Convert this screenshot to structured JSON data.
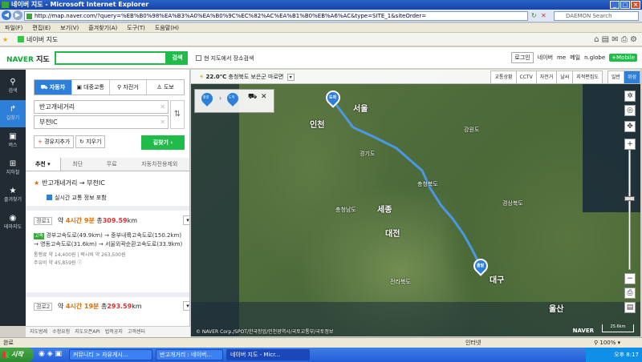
{
  "browser": {
    "title": "네이버 지도 - Microsoft Internet Explorer",
    "url": "http://map.naver.com/?query=%EB%B0%98%EA%B3%A0%EA%B0%9C%EC%82%AC%EA%B1%B0%EB%A6%AC&type=SITE_1&siteOrder=",
    "search_placeholder": "DAEMON Search",
    "menu": [
      "파일(F)",
      "편집(E)",
      "보기(V)",
      "즐겨찾기(A)",
      "도구(T)",
      "도움말(H)"
    ],
    "tab_label": "네이버 지도"
  },
  "header": {
    "logo": "NAVER",
    "logo_sub": "지도",
    "search_button": "검색",
    "checkbox_label": "현 지도에서 장소검색",
    "login": "로그인",
    "links": [
      "네이버",
      "me",
      "메일",
      "n.globe"
    ],
    "mobile": "+Mobile"
  },
  "leftnav": [
    {
      "icon": "search-icon",
      "label": "검색"
    },
    {
      "icon": "directions-icon",
      "label": "길찾기"
    },
    {
      "icon": "bus-icon",
      "label": "버스"
    },
    {
      "icon": "subway-icon",
      "label": "지하철"
    },
    {
      "icon": "star-icon",
      "label": "즐겨찾기"
    },
    {
      "icon": "themes-icon",
      "label": "테마지도"
    }
  ],
  "panel": {
    "modes": [
      "자동차",
      "대중교통",
      "자전거",
      "도보"
    ],
    "origin": "반고개네거리",
    "destination": "부천IC",
    "add_waypoint": "경유지추가",
    "clear": "지우기",
    "go": "길찾기",
    "option_tabs": [
      "추천",
      "최단",
      "무료",
      "자동차전용제외"
    ],
    "route_title": "반고개네거리 → 부천IC",
    "realtime": "실시간 교통 정보 포함",
    "routes": [
      {
        "label": "경로1",
        "prefix": "약",
        "time": "4시간 9분",
        "total": "총",
        "distance": "309.59",
        "unit": "km",
        "desc": "경부고속도로(49.9km) → 중부내륙고속도로(150.2km) → 영동고속도로(31.6km) → 서울외곽순환고속도로(33.9km)",
        "toll": "통행료 약 14,400원",
        "taxi": "택시비 약 263,500원",
        "fuel": "주유비 약 45,859원"
      },
      {
        "label": "경로2",
        "prefix": "약",
        "time": "4시간 19분",
        "total": "총",
        "distance": "293.59",
        "unit": "km"
      }
    ],
    "footer_links": [
      "지도범례",
      "수정요청",
      "지도오픈API",
      "법적공지",
      "고객센터"
    ]
  },
  "map": {
    "temperature": "22.0℃",
    "weather_region": "충청북도 보은군 마로면",
    "buttons": [
      "교통상황",
      "CCTV",
      "자전거",
      "날씨",
      "지적편집도",
      "일반",
      "위성"
    ],
    "active_button": "위성",
    "origin_pin": "출발",
    "dest_pin": "도착",
    "places": [
      {
        "name": "서울",
        "big": true
      },
      {
        "name": "인천",
        "big": false
      },
      {
        "name": "강원도",
        "big": false
      },
      {
        "name": "경기도",
        "big": false
      },
      {
        "name": "충청북도",
        "big": false
      },
      {
        "name": "충청남도",
        "big": false
      },
      {
        "name": "세종",
        "big": false
      },
      {
        "name": "대전",
        "big": false
      },
      {
        "name": "경상북도",
        "big": false
      },
      {
        "name": "대구",
        "big": true
      },
      {
        "name": "전라북도",
        "big": false
      },
      {
        "name": "울산",
        "big": false
      }
    ],
    "copyright": "© NAVER Corp./SPOT/한국항업/인천광역시/국토교통부/국토정보",
    "logo": "NAVER",
    "scale": "25.6km"
  },
  "statusbar": {
    "left": "완료",
    "zone": "인터넷",
    "zoom": "100%"
  },
  "taskbar": {
    "start": "시작",
    "tasks": [
      "커뮤니티 > 자유게시...",
      "반고개거리 : 네이버...",
      "네이버 지도 - Micr..."
    ],
    "clock": "오후 8:17"
  },
  "colors": {
    "naver_green": "#1fbc4a",
    "route_blue": "#2d7fd8",
    "accent_orange": "#e26d00"
  }
}
